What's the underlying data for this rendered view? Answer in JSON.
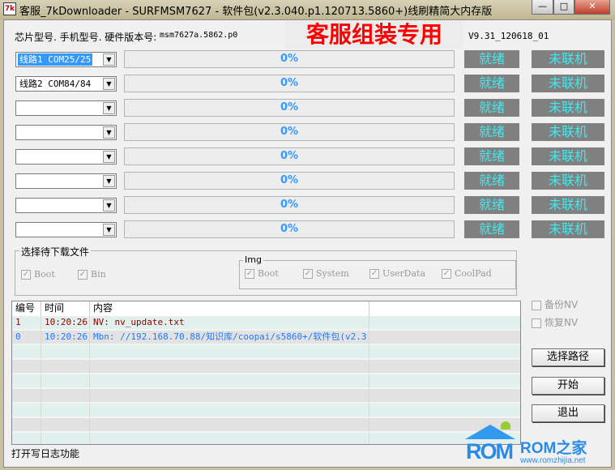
{
  "window": {
    "title": "客服_7kDownloader - SURFMSM7627 - 软件包(v2.3.040.p1.120713.5860+)线刷精简大内存版",
    "icon_text": "7k",
    "minimize": "—",
    "maximize": "□",
    "close": "✕"
  },
  "header": {
    "info_label": "芯片型号. 手机型号. 硬件版本号:",
    "info_value": "msm7627a.5862.p0",
    "banner": "客服组装专用",
    "version": "V9.31_120618_01"
  },
  "ports": [
    {
      "combo": "线路1  COM25/25",
      "selected": true,
      "progress": "0%",
      "status": "就绪",
      "link": "未联机"
    },
    {
      "combo": "线路2  COM84/84",
      "selected": false,
      "progress": "0%",
      "status": "就绪",
      "link": "未联机"
    },
    {
      "combo": "",
      "progress": "0%",
      "status": "就绪",
      "link": "未联机"
    },
    {
      "combo": "",
      "progress": "0%",
      "status": "就绪",
      "link": "未联机"
    },
    {
      "combo": "",
      "progress": "0%",
      "status": "就绪",
      "link": "未联机"
    },
    {
      "combo": "",
      "progress": "0%",
      "status": "就绪",
      "link": "未联机"
    },
    {
      "combo": "",
      "progress": "0%",
      "status": "就绪",
      "link": "未联机"
    },
    {
      "combo": "",
      "progress": "0%",
      "status": "就绪",
      "link": "未联机"
    }
  ],
  "files": {
    "title": "选择待下载文件",
    "boot": "Boot",
    "bin": "Bin",
    "img_title": "Img",
    "img_boot": "Boot",
    "img_system": "System",
    "img_userdata": "UserData",
    "img_coolpad": "CoolPad"
  },
  "log": {
    "columns": [
      "编号",
      "时间",
      "内容",
      ""
    ],
    "rows": [
      {
        "id": "1",
        "time": "10:20:26",
        "content": "NV: nv_update.txt",
        "color": "#8b0000"
      },
      {
        "id": "0",
        "time": "10:20:26",
        "content": "Mbn: //192.168.70.88/知识库/coopai/s5860+/软件包(v2.3...",
        "color": "#1e78ff"
      }
    ]
  },
  "options": {
    "backup_nv": "备份NV",
    "restore_nv": "恢复NV"
  },
  "buttons": {
    "select_path": "选择路径",
    "start": "开始",
    "exit": "退出"
  },
  "footer": {
    "log_toggle": "打开写日志功能"
  },
  "watermark": {
    "logo": "ROM",
    "brand": "ROM之家",
    "url": "www.romzhijia.net"
  },
  "colors": {
    "status_bg": "#808080",
    "status_text": "#40e8f0",
    "progress_text": "#3399ff",
    "banner": "#ff0000"
  }
}
